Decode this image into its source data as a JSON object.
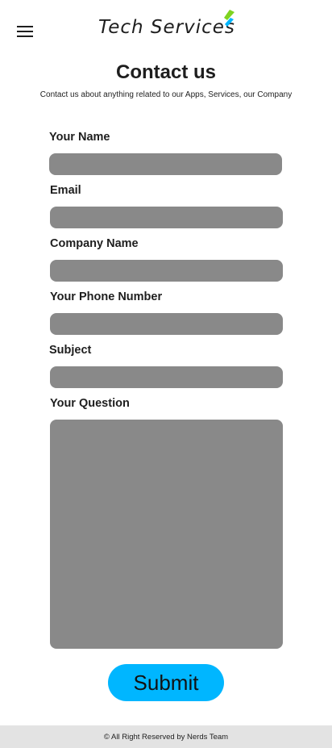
{
  "header": {
    "menu_icon": "hamburger-menu-icon",
    "logo_text": "Tech Services",
    "logo_leaf_colors": [
      "#7fd320",
      "#00b6ff"
    ]
  },
  "page": {
    "title": "Contact us",
    "subtitle": "Contact us about anything related to our Apps, Services, our Company"
  },
  "form": {
    "fields": [
      {
        "label": "Your Name",
        "value": ""
      },
      {
        "label": "Email",
        "value": ""
      },
      {
        "label": "Company Name",
        "value": ""
      },
      {
        "label": "Your Phone Number",
        "value": ""
      },
      {
        "label": "Subject",
        "value": ""
      },
      {
        "label": "Your Question",
        "value": ""
      }
    ],
    "submit_label": "Submit"
  },
  "footer": {
    "text": "© All Right Reserved by Nerds Team"
  },
  "colors": {
    "input_bg": "#898989",
    "button_bg": "#00b6ff",
    "footer_bg": "#e3e3e3"
  }
}
